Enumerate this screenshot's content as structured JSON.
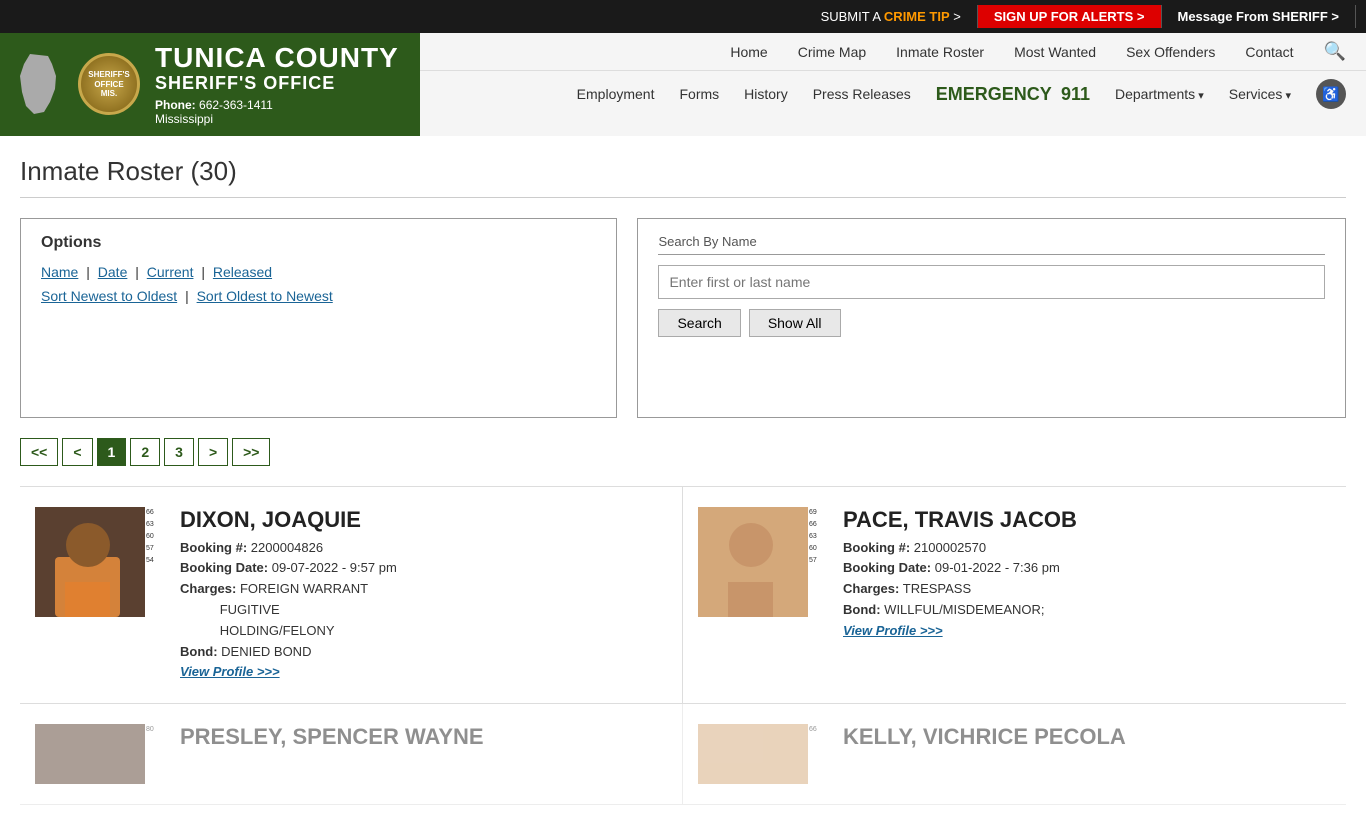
{
  "topbar": {
    "crime_tip_prefix": "SUBMIT A ",
    "crime_tip_highlight": "CRIME TIP",
    "crime_tip_arrow": " >",
    "alerts_prefix": "SIGN UP FOR ",
    "alerts_highlight": "ALERTS",
    "alerts_arrow": " >",
    "sheriff_prefix": "Message From ",
    "sheriff_highlight": "SHERIFF",
    "sheriff_arrow": " >"
  },
  "header": {
    "county": "TUNICA COUNTY",
    "office": "SHERIFF'S OFFICE",
    "phone_label": "Phone:",
    "phone": "662-363-1411",
    "state": "Mississippi",
    "nav_top": [
      "Home",
      "Crime Map",
      "Inmate Roster",
      "Most Wanted",
      "Sex Offenders",
      "Contact"
    ],
    "nav_bottom_emergency": "EMERGENCY",
    "nav_bottom_911": "911",
    "nav_bottom": [
      "Employment",
      "Forms",
      "History",
      "Press Releases"
    ],
    "nav_dropdowns": [
      "Departments",
      "Services"
    ]
  },
  "page": {
    "title": "Inmate Roster (30)"
  },
  "options": {
    "heading": "Options",
    "links_row1": [
      "Name",
      "Date",
      "Current",
      "Released"
    ],
    "links_row2": [
      "Sort Newest to Oldest",
      "Sort Oldest to Newest"
    ]
  },
  "search": {
    "legend": "Search By Name",
    "placeholder": "Enter first or last name",
    "search_btn": "Search",
    "show_all_btn": "Show All"
  },
  "pagination": {
    "first": "<<",
    "prev": "<",
    "pages": [
      "1",
      "2",
      "3"
    ],
    "next": ">",
    "last": ">>",
    "active": "1"
  },
  "inmates": [
    {
      "name": "DIXON, JOAQUIE",
      "booking_num": "2200004826",
      "booking_date": "09-07-2022 - 9:57 pm",
      "charges": "FOREIGN WARRANT FUGITIVE HOLDING/FELONY",
      "bond": "DENIED BOND",
      "view_profile": "View Profile >>>",
      "photo_tone": "dark"
    },
    {
      "name": "PACE, TRAVIS JACOB",
      "booking_num": "2100002570",
      "booking_date": "09-01-2022 - 7:36 pm",
      "charges": "TRESPASS",
      "bond": "WILLFUL/MISDEMEANOR;",
      "view_profile": "View Profile >>>",
      "photo_tone": "light"
    },
    {
      "name": "PRESLEY, SPENCER WAYNE",
      "booking_num": "",
      "booking_date": "",
      "charges": "",
      "bond": "",
      "view_profile": "",
      "photo_tone": "dark"
    },
    {
      "name": "KELLY, VICHRICE PECOLA",
      "booking_num": "",
      "booking_date": "",
      "charges": "",
      "bond": "",
      "view_profile": "",
      "photo_tone": "light"
    }
  ],
  "labels": {
    "booking_num": "Booking #:",
    "booking_date": "Booking Date:",
    "charges": "Charges:",
    "bond": "Bond:"
  }
}
